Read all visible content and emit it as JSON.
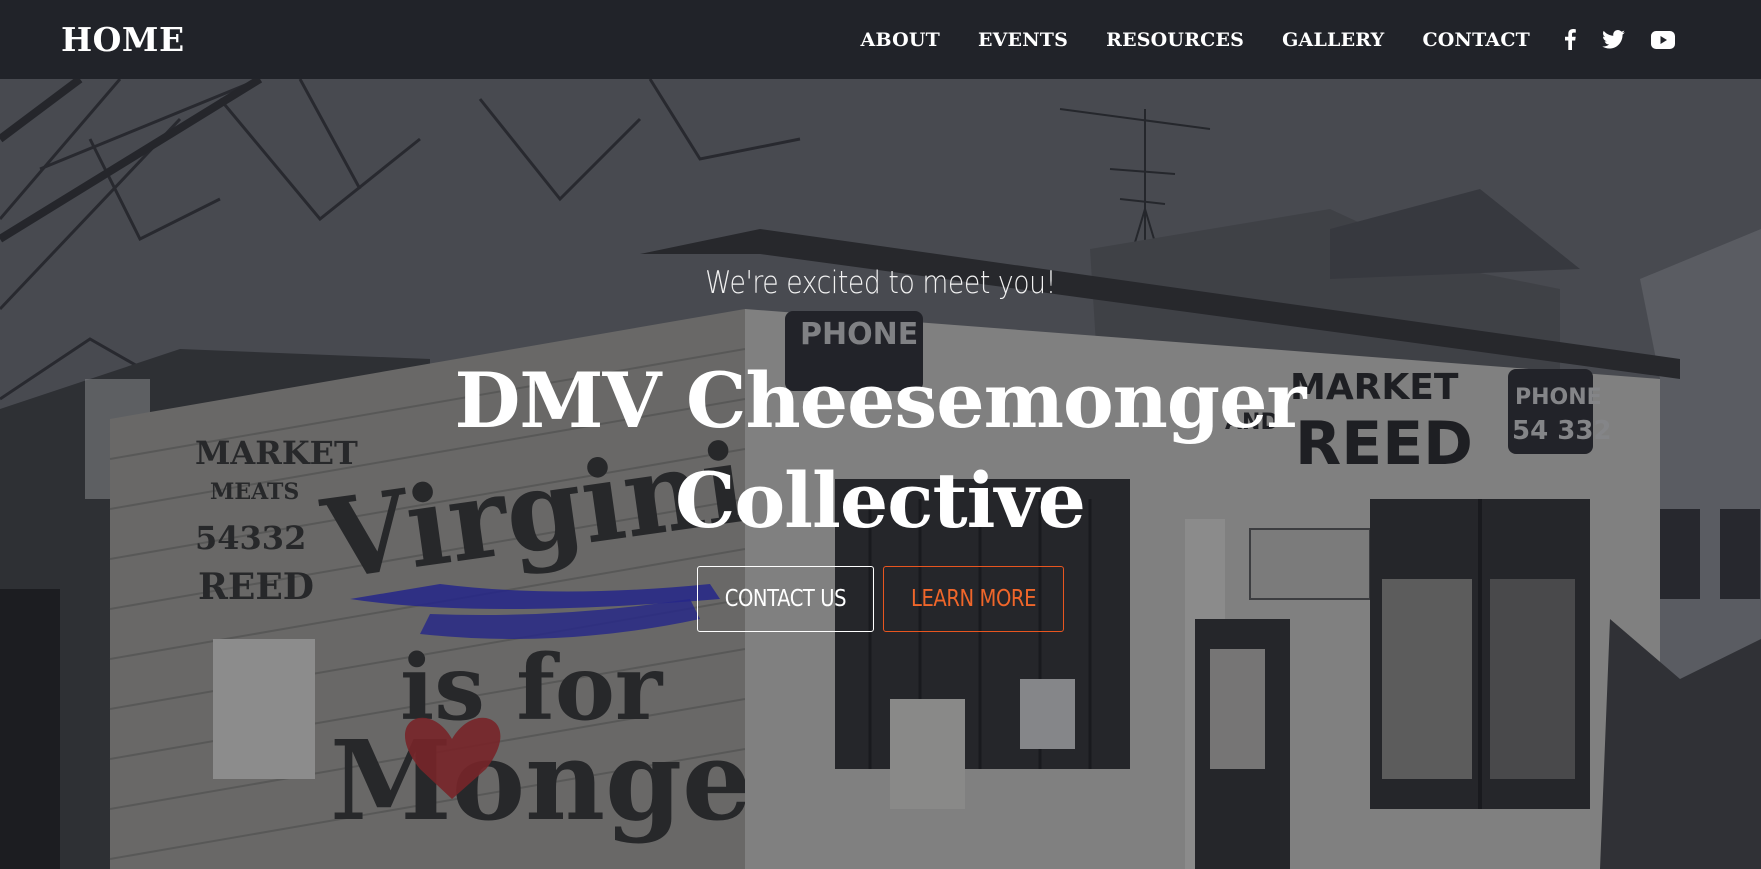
{
  "navbar": {
    "brand": "HOME",
    "links": [
      "ABOUT",
      "EVENTS",
      "RESOURCES",
      "GALLERY",
      "CONTACT"
    ],
    "social_icons": [
      "facebook-icon",
      "twitter-icon",
      "youtube-icon"
    ]
  },
  "hero": {
    "tagline": "We're excited to meet you!",
    "title_line1": "DMV Cheesemonger",
    "title_line2": "Collective",
    "primary_button": "CONTACT US",
    "secondary_button": "LEARN MORE",
    "background_image": {
      "description_text": {
        "mural_line1": "Virginia",
        "mural_line2": "is for",
        "mural_line3": "Mongers",
        "sign_phone_left": "PHONE",
        "sign_market": "MARKET",
        "sign_and": "AND",
        "sign_reed": "REED",
        "sign_phone_right": "PHONE",
        "sign_phone_number": "54 332",
        "side_market": "MARKET",
        "side_meats": "MEATS",
        "side_number": "54332",
        "side_reed": "REED"
      }
    }
  },
  "colors": {
    "navbar_bg": "#212329",
    "text": "#ffffff",
    "accent": "#e8551f",
    "mural_blue": "#2a2ad8",
    "mural_heart": "#c0282a"
  }
}
